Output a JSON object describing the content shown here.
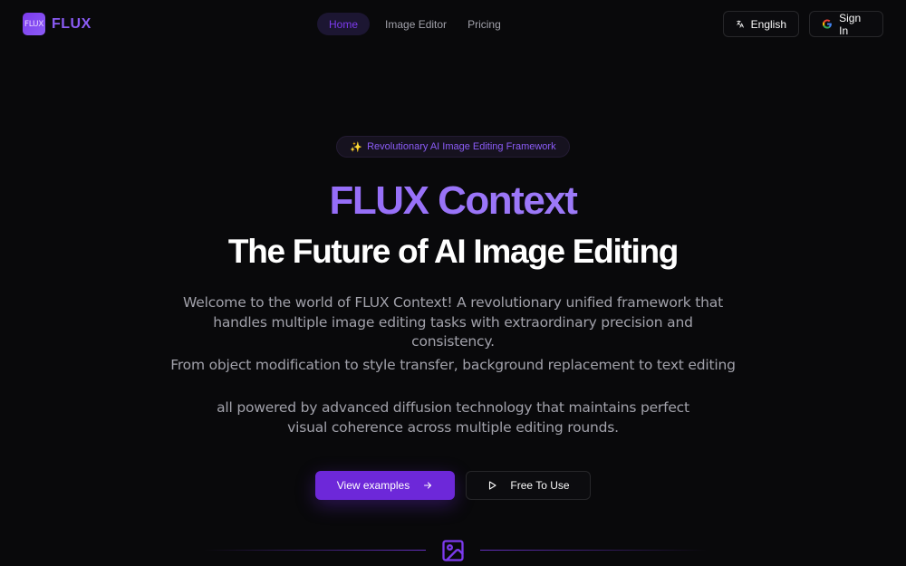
{
  "header": {
    "logo_badge": "FLUX",
    "logo_text": "FLUX",
    "nav": [
      {
        "label": "Home",
        "active": true
      },
      {
        "label": "Image Editor",
        "active": false
      },
      {
        "label": "Pricing",
        "active": false
      }
    ],
    "language_label": "English",
    "signin_label": "Sign In"
  },
  "hero": {
    "badge_icon": "sparkles-icon",
    "badge_text": "Revolutionary AI Image Editing Framework",
    "title": "FLUX Context",
    "subtitle": "The Future of AI Image Editing",
    "paragraph_1": "Welcome to the world of FLUX Context! A revolutionary unified framework that handles multiple image editing tasks with extraordinary precision and consistency.",
    "paragraph_2": "From object modification to style transfer, background replacement to text editing",
    "paragraph_3": "all powered by advanced diffusion technology that maintains perfect visual coherence across multiple editing rounds.",
    "cta_primary": "View examples",
    "cta_secondary": "Free To Use",
    "section_icon": "image-icon"
  },
  "colors": {
    "background": "#09090b",
    "accent": "#8b5cf6",
    "primary_button": "#6d28d9",
    "muted_text": "#a1a1aa"
  }
}
